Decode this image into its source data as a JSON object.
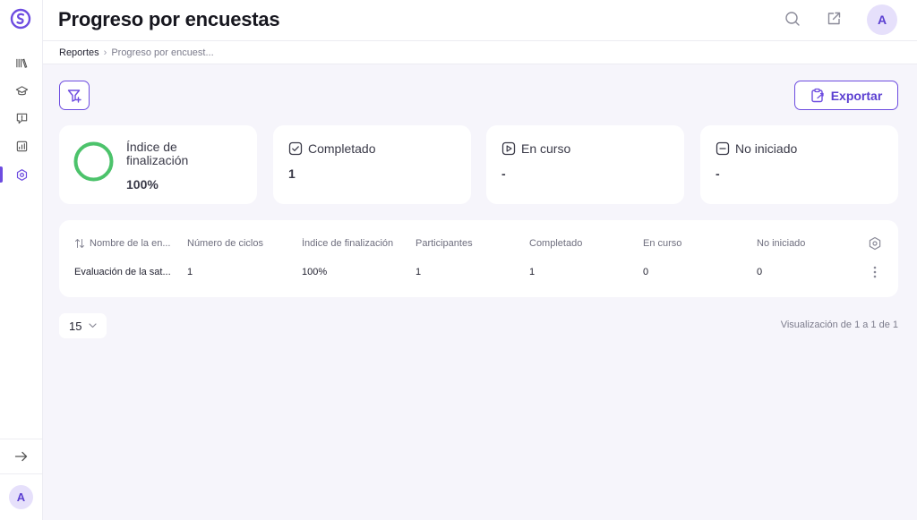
{
  "header": {
    "title": "Progreso por encuestas",
    "avatar_initial": "A"
  },
  "breadcrumb": {
    "root": "Reportes",
    "separator": "›",
    "current": "Progreso por encuest..."
  },
  "toolbar": {
    "export_label": "Exportar"
  },
  "sidebar": {
    "avatar_initial": "A",
    "items": [
      {
        "icon": "books-icon",
        "active": false
      },
      {
        "icon": "graduation-cap-icon",
        "active": false
      },
      {
        "icon": "feedback-icon",
        "active": false
      },
      {
        "icon": "analytics-icon",
        "active": false
      },
      {
        "icon": "survey-hexagon-icon",
        "active": true
      }
    ]
  },
  "cards": {
    "completion": {
      "title": "Índice de finalización",
      "value": "100%",
      "progress": 1.0
    },
    "completed": {
      "title": "Completado",
      "value": "1"
    },
    "in_progress": {
      "title": "En curso",
      "value": "-"
    },
    "not_started": {
      "title": "No iniciado",
      "value": "-"
    }
  },
  "table": {
    "columns": [
      "Nombre de la en...",
      "Número de ciclos",
      "Índice de finalización",
      "Participantes",
      "Completado",
      "En curso",
      "No iniciado"
    ],
    "rows": [
      [
        "Evaluación de la sat...",
        "1",
        "100%",
        "1",
        "1",
        "0",
        "0"
      ]
    ]
  },
  "pagination": {
    "page_size": "15",
    "info": "Visualización de 1 a 1 de 1"
  },
  "colors": {
    "accent": "#6d4ce0",
    "success": "#4cc36b",
    "background": "#f6f5fb"
  }
}
